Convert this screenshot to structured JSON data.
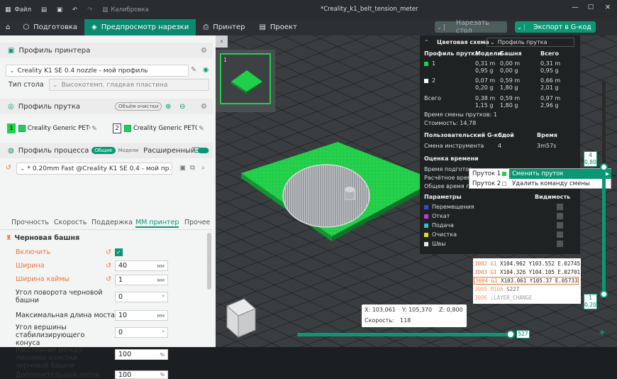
{
  "titlebar": {
    "file": "Файл",
    "calibration": "Калибровка",
    "title": "*Creality_k1_belt_tension_meter"
  },
  "tabs": [
    {
      "label": "Подготовка"
    },
    {
      "label": "Предпросмотр нарезки"
    },
    {
      "label": "Принтер"
    },
    {
      "label": "Проект"
    }
  ],
  "actions": {
    "slice": "Нарезать стол",
    "export": "Экспорт в G-код"
  },
  "printer": {
    "section": "Профиль принтера",
    "profile": "Creality K1 SE 0.4 nozzle - мой профиль",
    "bed_label": "Тип стола",
    "bed_value": "Высокотемп. гладкая пластина"
  },
  "filament": {
    "section": "Профиль прутка",
    "purge_button": "Объём очистки",
    "slot1_num": "1",
    "slot1_name": "Creality Generic PETG...",
    "slot2_num": "2",
    "slot2_name": "Creality Generic PETG..."
  },
  "process": {
    "section": "Профиль процесса",
    "toggle_general": "Общие",
    "toggle_models": "Модели",
    "advanced": "Расширенный",
    "profile": "* 0.20mm Fast @Creality K1 SE 0.4 - мой пр..."
  },
  "subtabs": [
    "Прочность",
    "Скорость",
    "Поддержка",
    "ММ принтер",
    "Прочее"
  ],
  "tower": {
    "title": "Черновая башня",
    "fields": [
      {
        "label": "Включить",
        "value": "",
        "unit": ""
      },
      {
        "label": "Ширина",
        "value": "40",
        "unit": "мм"
      },
      {
        "label": "Ширина каймы",
        "value": "1",
        "unit": "мм"
      },
      {
        "label": "Угол поворота черновой башни",
        "value": "0",
        "unit": "°"
      },
      {
        "label": "Максимальная длина моста",
        "value": "10",
        "unit": "мм"
      },
      {
        "label": "Угол вершины стабилизирующего конуса",
        "value": "0",
        "unit": "°"
      },
      {
        "label": "Расстояние между линиями очистки черновой башни",
        "value": "100",
        "unit": "%"
      },
      {
        "label": "Дополнительный поток",
        "value": "100",
        "unit": "%"
      }
    ]
  },
  "plate": {
    "number": "1"
  },
  "legend": {
    "scheme_label": "Цветовая схема",
    "scheme_value": "Профиль прутка",
    "headers": [
      "Профиль прутка",
      "Модели",
      "Башня",
      "Всего"
    ],
    "rows": [
      {
        "idx": "1",
        "color": "#21d04a",
        "models": "0,31 m\n0,95 g",
        "tower": "0,00 m\n0,00 g",
        "total": "0,31 m\n0,95 g"
      },
      {
        "idx": "2",
        "color": "#ffffff",
        "models": "0,07 m\n0,20 g",
        "tower": "0,59 m\n1,80 g",
        "total": "0,66 m\n2,01 g"
      }
    ],
    "sum": {
      "label": "Всего",
      "models": "0,38 m\n1,15 g",
      "tower": "0,59 m\n1,80 g",
      "total": "0,97 m\n2,96 g"
    },
    "changes": "Время смены прутков: 1",
    "cost": "Стоимость: 14,78",
    "custom_gcode": "Пользовательский G-код",
    "layer": "Слой",
    "time": "Время",
    "tool_change": "Смена инструмента",
    "tool_layer": "4",
    "tool_time": "3m57s",
    "estimate": "Оценка времени",
    "prep": "Время подготов",
    "calc": "Расчётное время",
    "total_time": "Общее время п",
    "params": "Параметры",
    "visibility": "Видимость",
    "items": [
      {
        "label": "Перемещения",
        "color": "#3b4bd0"
      },
      {
        "label": "Откат",
        "color": "#c23bd0"
      },
      {
        "label": "Подача",
        "color": "#3bb8d0"
      },
      {
        "label": "Очистка",
        "color": "#e5d43b"
      },
      {
        "label": "Швы",
        "color": "#e8e8e8"
      }
    ]
  },
  "context_menu": {
    "item1": "Пруток 1",
    "item2": "Пруток 2",
    "change": "Сменить пруток",
    "delete": "Удалить команду смены прутка"
  },
  "gcode": [
    {
      "line": "3002",
      "cmd": "G1",
      "args": "X104.962 Y103.552 E.02745"
    },
    {
      "line": "3003",
      "cmd": "G1",
      "args": "X104.326 Y104.105 E.02701"
    },
    {
      "line": "3004",
      "cmd": "G1",
      "args": "X103.061 Y105.37 E.05733"
    },
    {
      "line": "3005",
      "cmd": "M106",
      "args": "S227"
    },
    {
      "line": "3006",
      "cmd": ";LAYER_CHANGE",
      "args": ""
    }
  ],
  "status": {
    "x": "X: 103,061",
    "y": "Y: 105,370",
    "z": "Z: 0,800",
    "speed_label": "Скорость:",
    "speed": "118"
  },
  "vslider": {
    "top_layer": "4",
    "top_height": "0,80",
    "bottom_layer": "1",
    "bottom_height": "0,20"
  },
  "hslider": {
    "value": "527"
  }
}
